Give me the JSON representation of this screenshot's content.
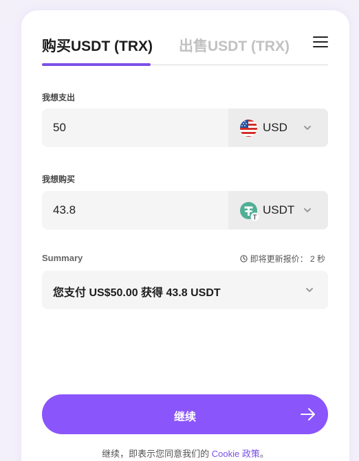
{
  "tabs": {
    "buy": "购买USDT (TRX)",
    "sell": "出售USDT (TRX)"
  },
  "spend": {
    "label": "我想支出",
    "value": "50",
    "currency": "USD",
    "flag_icon": "us-flag-icon"
  },
  "receive": {
    "label": "我想购买",
    "value": "43.8",
    "currency": "USDT",
    "token_icon": "tether-icon"
  },
  "summary": {
    "label": "Summary",
    "refresh_text": "即将更新报价： 2 秒",
    "text": "您支付 US$50.00 获得 43.8 USDT"
  },
  "continue_label": "继续",
  "footer": {
    "prefix": "继续，即表示您同意我们的 ",
    "link": "Cookie 政策",
    "suffix": "。"
  },
  "colors": {
    "accent": "#8a55fb",
    "tether_green": "#50af95"
  }
}
